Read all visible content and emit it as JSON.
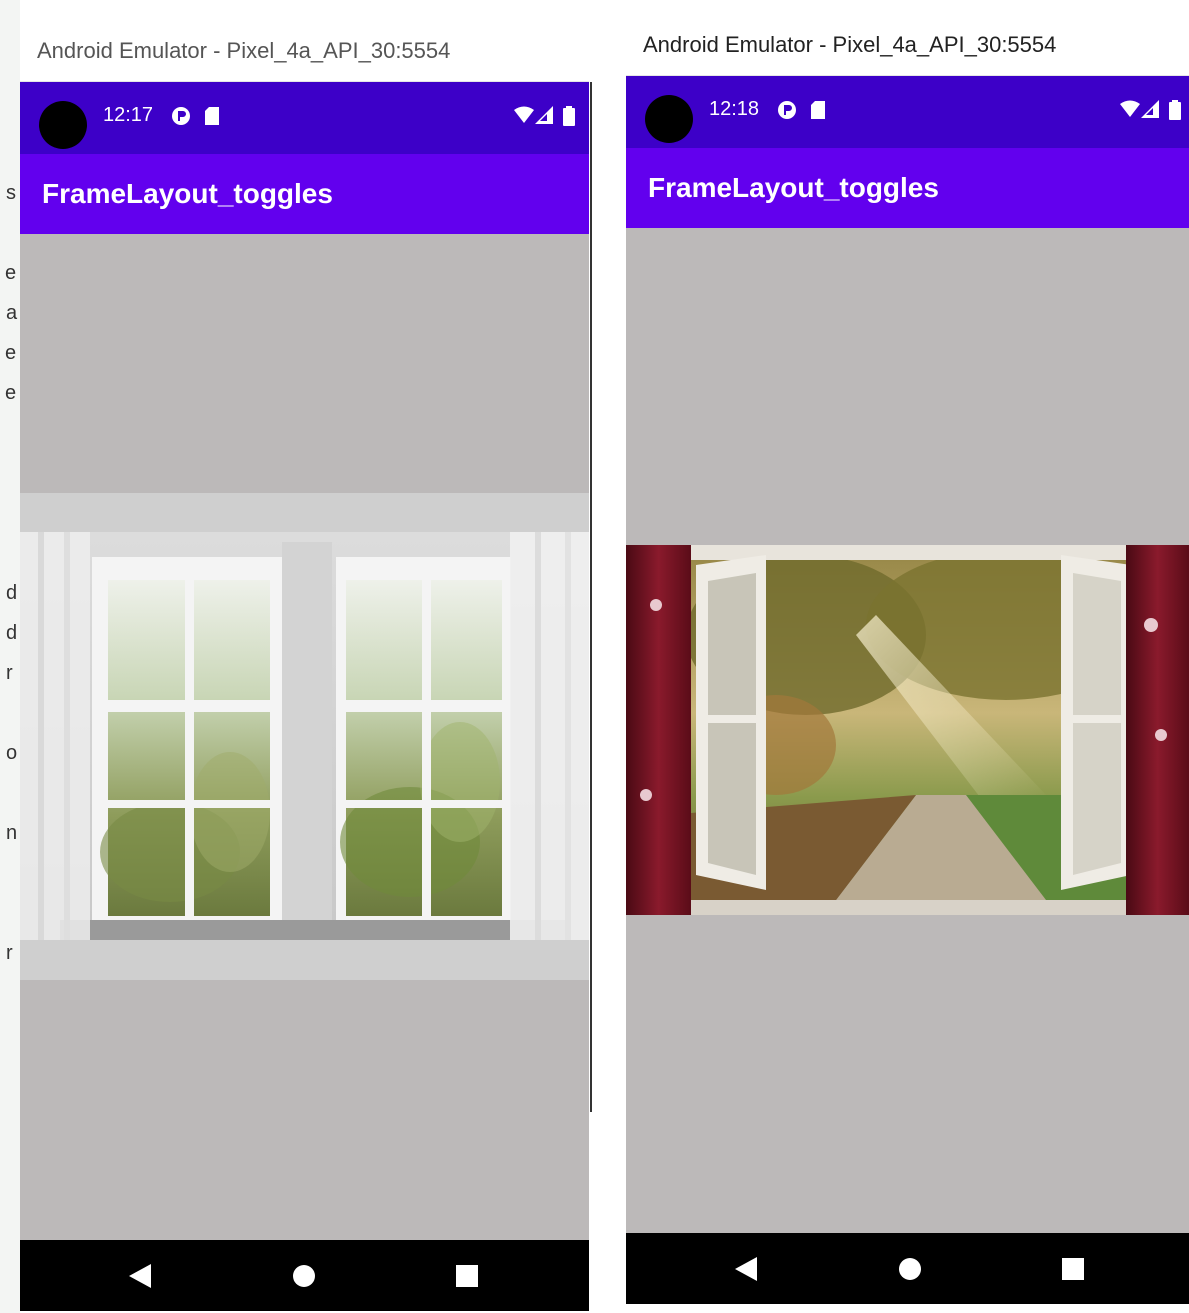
{
  "left_screen": {
    "window_title": "Android Emulator - Pixel_4a_API_30:5554",
    "status_time": "12:17",
    "app_title": "FrameLayout_toggles",
    "image_icon": "white-window-with-curtains"
  },
  "right_screen": {
    "window_title": "Android Emulator - Pixel_4a_API_30:5554",
    "status_time": "12:18",
    "app_title": "FrameLayout_toggles",
    "image_icon": "open-window-forest-path"
  },
  "nav": {
    "back_icon": "back-triangle-icon",
    "home_icon": "home-circle-icon",
    "recents_icon": "recents-square-icon"
  },
  "colors": {
    "status_bar": "#3d00c8",
    "app_bar": "#6200ee",
    "content_bg": "#bcb9b9",
    "nav_bar": "#000000"
  }
}
